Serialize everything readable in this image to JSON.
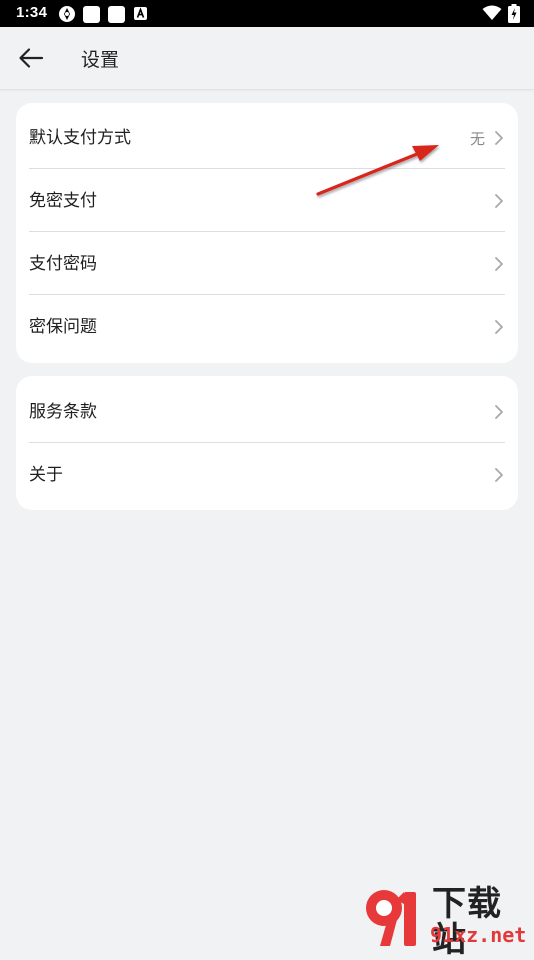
{
  "status_bar": {
    "time": "1:34"
  },
  "header": {
    "title": "设置"
  },
  "sections": [
    {
      "items": [
        {
          "label": "默认支付方式",
          "value": "无"
        },
        {
          "label": "免密支付"
        },
        {
          "label": "支付密码"
        },
        {
          "label": "密保问题"
        }
      ]
    },
    {
      "items": [
        {
          "label": "服务条款"
        },
        {
          "label": "关于"
        }
      ]
    }
  ],
  "watermark": {
    "title": "下载站",
    "domain": "91xz.net"
  },
  "colors": {
    "background": "#f1f2f4",
    "card": "#ffffff",
    "text": "#1f1f1f",
    "secondary_text": "#8a8a8a",
    "annotation_arrow": "#d8261f"
  }
}
